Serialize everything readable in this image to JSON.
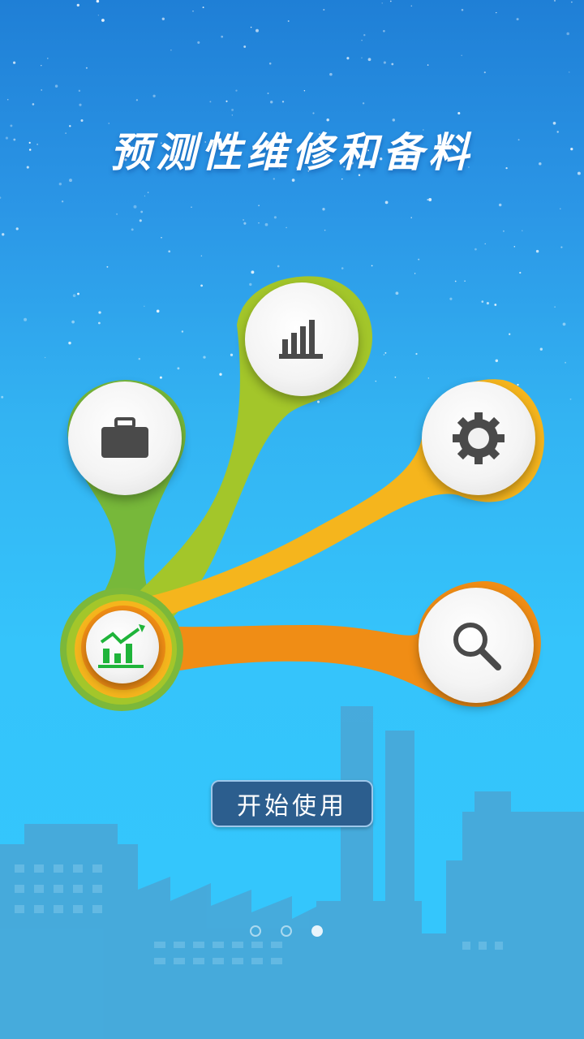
{
  "header": {
    "title": "预测性维修和备料"
  },
  "actions": {
    "start_label": "开始使用"
  },
  "menu": {
    "items": [
      {
        "name": "briefcase",
        "color": "#7cba3a",
        "icon": "briefcase-icon"
      },
      {
        "name": "bar-chart",
        "color": "#a6c824",
        "icon": "bar-chart-icon"
      },
      {
        "name": "settings",
        "color": "#f6b41c",
        "icon": "gear-icon"
      },
      {
        "name": "search",
        "color": "#f08c14",
        "icon": "search-icon"
      }
    ],
    "hub": {
      "icon": "growth-chart-icon",
      "icon_color": "#1fb43a"
    }
  },
  "pager": {
    "total": 3,
    "active": 3
  },
  "colors": {
    "sky_top": "#1f7fd6",
    "sky_bottom": "#33c7fc",
    "factory": "#4aa6d6",
    "button": "#2c5e8e",
    "icon_dark": "#4a4a4a"
  }
}
